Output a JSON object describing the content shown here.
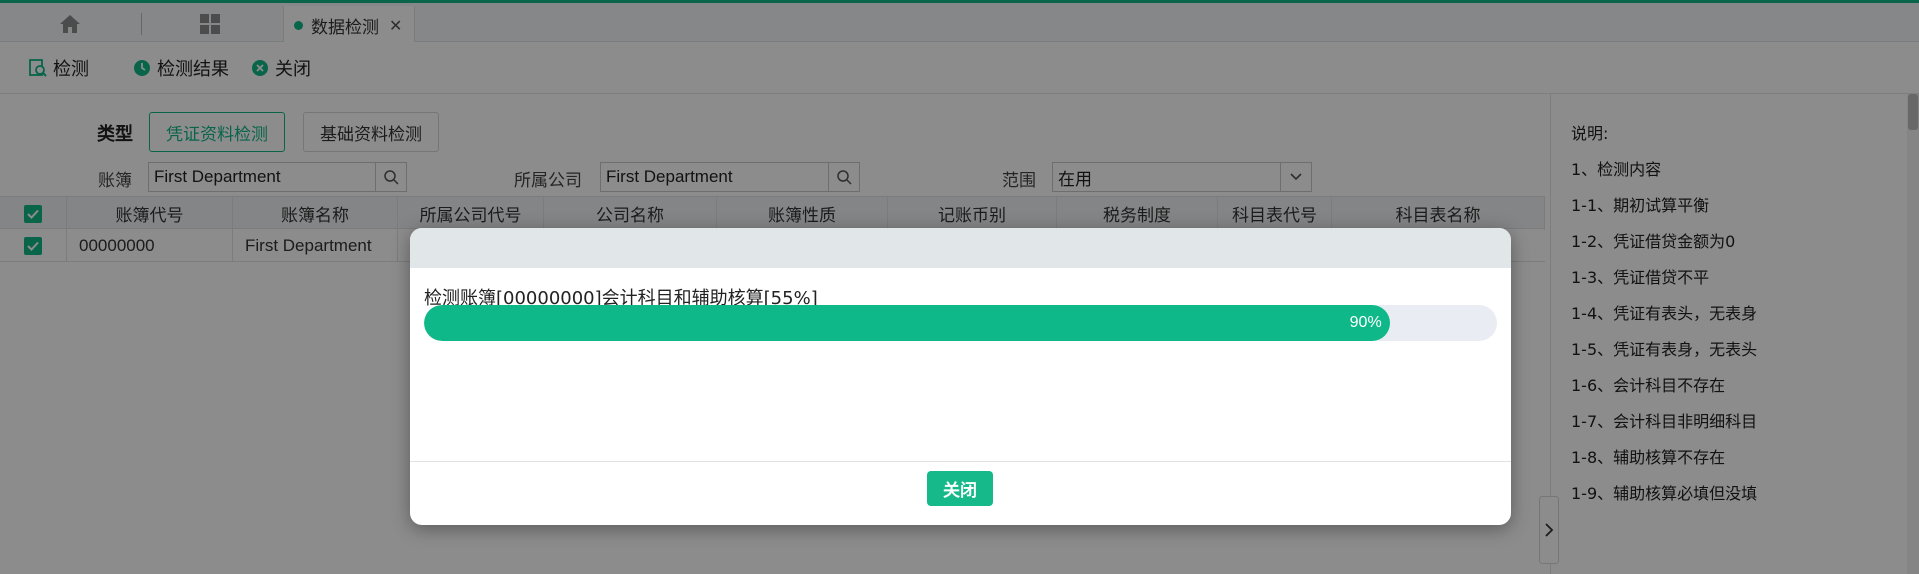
{
  "tabs": {
    "home_icon": "home-icon",
    "apps_icon": "grid-icon",
    "active_label": "数据检测"
  },
  "toolbar": {
    "detect": "检测",
    "result": "检测结果",
    "close": "关闭"
  },
  "filter": {
    "type_label": "类型",
    "type_options": [
      "凭证资料检测",
      "基础资料检测"
    ],
    "selected_type": "凭证资料检测",
    "ledger_label": "账簿",
    "ledger_value": "First Department",
    "company_label": "所属公司",
    "company_value": "First Department",
    "scope_label": "范围",
    "scope_value": "在用"
  },
  "table": {
    "columns": [
      "账簿代号",
      "账簿名称",
      "所属公司代号",
      "公司名称",
      "账簿性质",
      "记账币别",
      "税务制度",
      "科目表代号",
      "科目表名称"
    ],
    "rows": [
      {
        "code": "00000000",
        "name": "First Department"
      }
    ]
  },
  "info": {
    "lines": [
      "说明:",
      "1、检测内容",
      "1-1、期初试算平衡",
      "1-2、凭证借贷金额为0",
      "1-3、凭证借贷不平",
      "1-4、凭证有表头，无表身",
      "1-5、凭证有表身，无表头",
      "1-6、会计科目不存在",
      "1-7、会计科目非明细科目",
      "1-8、辅助核算不存在",
      "1-9、辅助核算必填但没填"
    ]
  },
  "dialog": {
    "message": "检测账簿[00000000]会计科目和辅助核算[55%]",
    "progress_percent": 90,
    "progress_label": "90%",
    "close_label": "关闭"
  },
  "colors": {
    "accent": "#12b886",
    "progress": "#0fb888"
  }
}
